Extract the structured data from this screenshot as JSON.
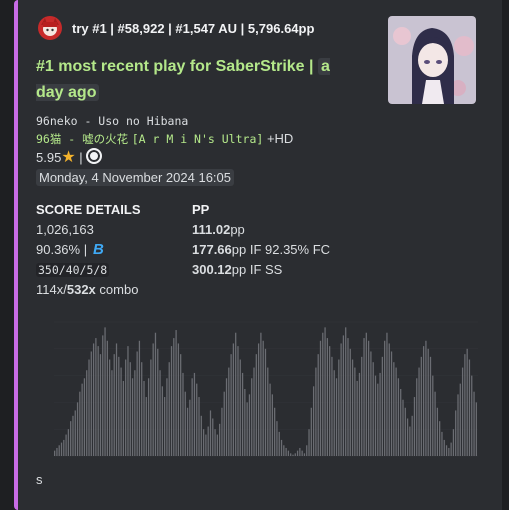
{
  "embed": {
    "accent_color": "#c86ce6",
    "author": "try #1 | #58,922 | #1,547 AU | 5,796.64pp",
    "title_main": "#1 most recent play for SaberStrike |",
    "title_time": "a day ago",
    "song_line": "96neko - Uso no Hibana",
    "beatmap_artist_title": "96猫 - 嘘の火花",
    "difficulty": "[A r M i N's Ultra]",
    "mods": "+HD",
    "star_rating": "5.95",
    "date": "Monday, 4 November 2024 16:05",
    "score_header": "SCORE DETAILS",
    "score": "1,026,163",
    "accuracy": "90.36% |",
    "hit_counts": "350/40/5/8",
    "combo_current": "114x",
    "combo_max": "532x",
    "combo_label": "combo",
    "pp_header": "PP",
    "pp_current": "111.02",
    "pp_unit": "pp",
    "pp_fc": "177.66",
    "pp_fc_label": "pp IF 92.35% FC",
    "pp_ss": "300.12",
    "pp_ss_label": "pp IF SS",
    "footer_text": "s"
  },
  "chart_data": {
    "type": "bar",
    "values": [
      4,
      6,
      8,
      10,
      12,
      16,
      20,
      26,
      30,
      34,
      40,
      48,
      54,
      58,
      64,
      72,
      78,
      84,
      88,
      82,
      76,
      90,
      96,
      86,
      72,
      64,
      76,
      84,
      74,
      66,
      56,
      72,
      82,
      70,
      58,
      64,
      78,
      86,
      70,
      56,
      44,
      58,
      72,
      84,
      92,
      80,
      64,
      52,
      44,
      58,
      70,
      82,
      88,
      94,
      84,
      76,
      62,
      48,
      36,
      42,
      58,
      62,
      54,
      44,
      30,
      20,
      16,
      22,
      34,
      28,
      20,
      16,
      24,
      36,
      48,
      58,
      66,
      76,
      84,
      92,
      82,
      72,
      62,
      50,
      40,
      46,
      58,
      66,
      76,
      84,
      92,
      86,
      80,
      66,
      54,
      46,
      36,
      26,
      18,
      12,
      8,
      6,
      4,
      2,
      1,
      2,
      4,
      6,
      4,
      2,
      8,
      20,
      36,
      52,
      66,
      76,
      86,
      92,
      96,
      88,
      82,
      74,
      64,
      58,
      72,
      84,
      90,
      96,
      88,
      80,
      72,
      66,
      56,
      62,
      74,
      88,
      92,
      86,
      78,
      70,
      60,
      54,
      62,
      74,
      86,
      92,
      84,
      78,
      70,
      66,
      58,
      50,
      42,
      36,
      28,
      22,
      30,
      44,
      58,
      66,
      74,
      82,
      86,
      80,
      74,
      60,
      48,
      36,
      26,
      18,
      12,
      8,
      6,
      10,
      20,
      34,
      46,
      54,
      66,
      76,
      80,
      72,
      60,
      48,
      40
    ],
    "ylim": [
      0,
      100
    ],
    "bar_color": "#6b6d73"
  }
}
